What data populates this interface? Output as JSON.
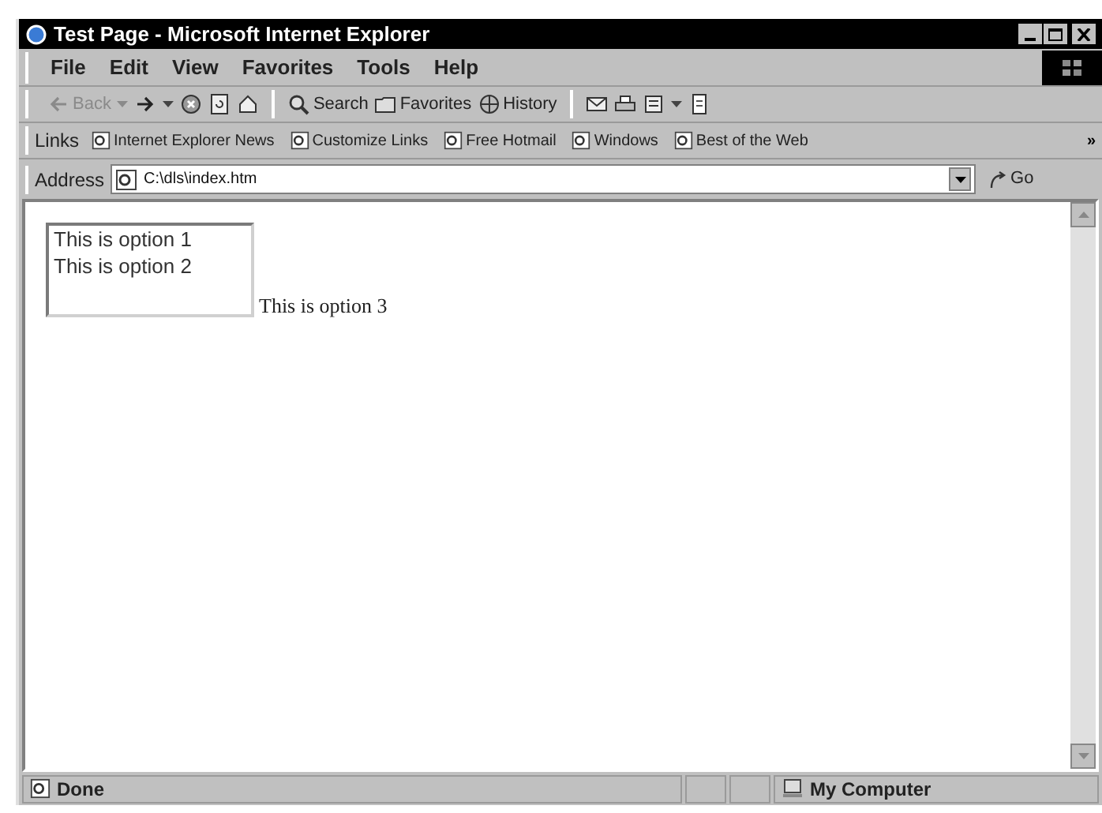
{
  "window": {
    "title": "Test Page - Microsoft Internet Explorer"
  },
  "menu": [
    "File",
    "Edit",
    "View",
    "Favorites",
    "Tools",
    "Help"
  ],
  "toolbar": [
    {
      "kind": "back",
      "label": "Back",
      "disabled": true
    },
    {
      "kind": "forward"
    },
    {
      "kind": "stop"
    },
    {
      "kind": "refresh"
    },
    {
      "kind": "home"
    },
    {
      "kind": "search",
      "label": "Search"
    },
    {
      "kind": "favorites",
      "label": "Favorites"
    },
    {
      "kind": "history",
      "label": "History"
    },
    {
      "kind": "mail"
    },
    {
      "kind": "print"
    },
    {
      "kind": "edit"
    },
    {
      "kind": "discuss"
    }
  ],
  "links": {
    "label": "Links",
    "items": [
      "Internet Explorer News",
      "Customize Links",
      "Free Hotmail",
      "Windows",
      "Best of the Web"
    ],
    "more": "»"
  },
  "address": {
    "label": "Address",
    "value": "C:\\dls\\index.htm",
    "go": "Go"
  },
  "page": {
    "listbox": [
      "This is option 1",
      "This is option 2"
    ],
    "trailing_text": "This is option 3"
  },
  "status_bar": {
    "text": "Done",
    "zone": "My Computer"
  }
}
